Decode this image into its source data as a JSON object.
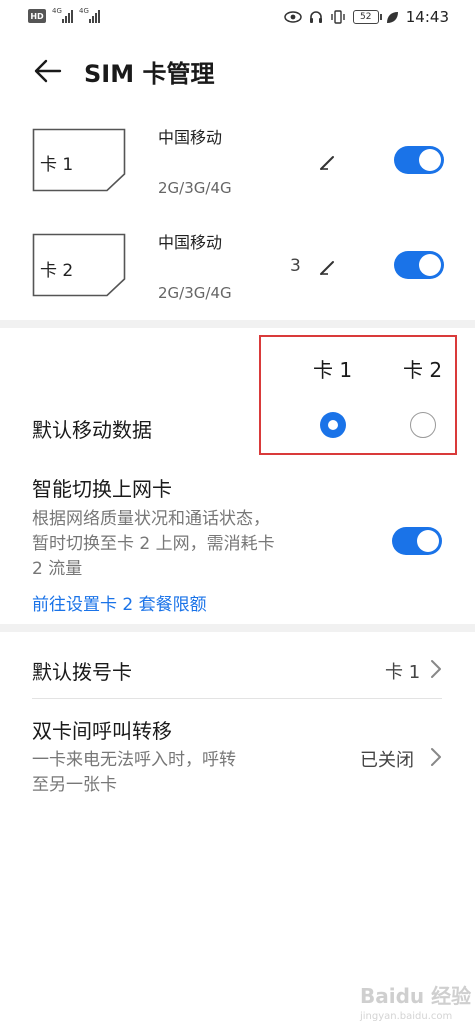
{
  "status_bar": {
    "hd": "HD",
    "signal1_tag": "4G",
    "signal2_tag": "4G",
    "battery": "52",
    "time": "14:43"
  },
  "header": {
    "title": "SIM 卡管理"
  },
  "sim_cards": [
    {
      "label": "卡 1",
      "carrier": "中国移动",
      "network": "2G/3G/4G",
      "enabled": true
    },
    {
      "label": "卡 2",
      "carrier": "中国移动",
      "network": "2G/3G/4G",
      "enabled": true,
      "stray_char": "3"
    }
  ],
  "default_data": {
    "col_card1": "卡 1",
    "col_card2": "卡 2",
    "title": "默认移动数据",
    "selected": "卡 1"
  },
  "smart_switch": {
    "title": "智能切换上网卡",
    "desc_lines": [
      "根据网络质量状况和通话状态，",
      "暂时切换至卡 2 上网，需消耗卡",
      "2 流量"
    ],
    "link": "前往设置卡 2 套餐限额",
    "enabled": true
  },
  "default_dial": {
    "title": "默认拨号卡",
    "value": "卡 1"
  },
  "call_forward": {
    "title": "双卡间呼叫转移",
    "desc_lines": [
      "一卡来电无法呼入时，呼转",
      "至另一张卡"
    ],
    "value": "已关闭"
  },
  "watermark": {
    "text": "Baidu 经验",
    "sub": "jingyan.baidu.com"
  },
  "colors": {
    "accent": "#1a73e8",
    "highlight_box": "#d93a3a"
  }
}
